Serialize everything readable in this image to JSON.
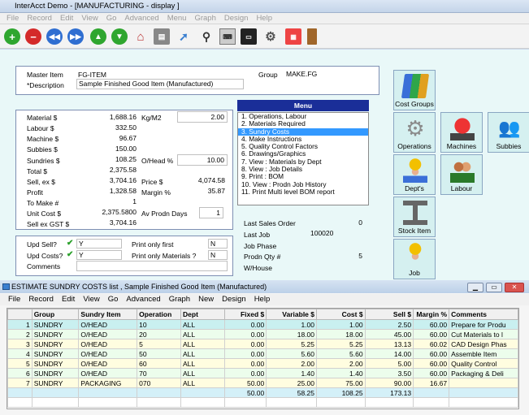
{
  "app": {
    "title": "InterAcct Demo - [MANUFACTURING - display ]"
  },
  "menubar": [
    "File",
    "Record",
    "Edit",
    "View",
    "Go",
    "Advanced",
    "Menu",
    "Graph",
    "Design",
    "Help"
  ],
  "toolbar": [
    "add-icon",
    "delete-icon",
    "first-icon",
    "previous-icon",
    "next-icon",
    "last-icon",
    "home-icon",
    "print-icon",
    "export-icon",
    "search-icon",
    "keyboard-icon",
    "monitor-icon",
    "settings-icon",
    "calendar-icon",
    "exit-door-icon"
  ],
  "header": {
    "master_item_label": "Master Item",
    "master_item_value": "FG-ITEM",
    "description_label": "*Description",
    "description_value": "Sample Finished Good Item (Manufactured)",
    "group_label": "Group",
    "group_value": "MAKE.FG"
  },
  "costs": {
    "material_label": "Material $",
    "material": "1,688.16",
    "labour_label": "Labour  $",
    "labour": "332.50",
    "machine_label": "Machine  $",
    "machine": "96.67",
    "subbies_label": "Subbies  $",
    "subbies": "150.00",
    "sundries_label": "Sundries $",
    "sundries": "108.25",
    "total_label": "Total  $",
    "total": "2,375.58",
    "sell_label": "Sell, ex $",
    "sell": "3,704.16",
    "profit_label": "Profit",
    "profit": "1,328.58",
    "tomake_label": "To Make #",
    "tomake": "1",
    "unitcost_label": "Unit Cost $",
    "unitcost": "2,375.5800",
    "sellgst_label": "Sell ex GST $",
    "sellgst": "3,704.16",
    "kgm2_label": "Kg/M2",
    "kgm2": "2.00",
    "ohead_label": "O/Head %",
    "ohead": "10.00",
    "price_label": "Price $",
    "price": "4,074.58",
    "margin_label": "Margin %",
    "margin": "35.87",
    "avprodn_label": "Av Prodn Days",
    "avprodn": "1"
  },
  "menu": {
    "title": "Menu",
    "items": [
      "1. Operations, Labour",
      "2. Materials Required",
      "3. Sundry Costs",
      "4. Make Instructions",
      "5. Quality Control Factors",
      "6. Drawings/Graphics",
      "7. View : Materials by Dept",
      "8. View : Job Details",
      "9. Print : BOM",
      "10. View : Prodn Job History",
      "11. Print Multi level BOM report"
    ],
    "selected_index": 2
  },
  "options": {
    "upd_sell_label": "Upd Sell?",
    "upd_sell": "Y",
    "upd_costs_label": "Upd Costs?",
    "upd_costs": "Y",
    "comments_label": "Comments",
    "print_first_label": "Print only first",
    "print_first": "N",
    "print_materials_label": "Print only Materials ?",
    "print_materials": "N"
  },
  "jobinfo": {
    "last_sales_order_label": "Last Sales Order",
    "last_sales_order": "0",
    "last_job_label": "Last Job",
    "last_job": "100020",
    "job_phase_label": "Job Phase",
    "prodn_qty_label": "Prodn Qty #",
    "prodn_qty": "5",
    "whouse_label": "W/House"
  },
  "buttons": [
    {
      "label": "Cost Groups",
      "icon": "books-icon"
    },
    {
      "label": "Operations",
      "icon": "gears-icon"
    },
    {
      "label": "Machines",
      "icon": "compressor-icon"
    },
    {
      "label": "Subbies",
      "icon": "people-icon"
    },
    {
      "label": "Dept's",
      "icon": "worker-icon"
    },
    {
      "label": "Labour",
      "icon": "labour-icon"
    },
    {
      "label": "Stock Item",
      "icon": "steel-beam-icon"
    },
    {
      "label": "Job",
      "icon": "job-worker-icon"
    }
  ],
  "subwindow": {
    "title": "ESTIMATE SUNDRY COSTS list , Sample Finished Good Item (Manufactured)",
    "menu": [
      "File",
      "Record",
      "Edit",
      "View",
      "Go",
      "Advanced",
      "Graph",
      "New",
      "Design",
      "Help"
    ],
    "columns": [
      "Group",
      "Sundry Item",
      "Operation",
      "Dept",
      "Fixed $",
      "Variable $",
      "Cost $",
      "Sell $",
      "Margin %",
      "Comments"
    ],
    "rows": [
      {
        "n": "1",
        "group": "SUNDRY",
        "item": "O/HEAD",
        "op": "10",
        "dept": "ALL",
        "fixed": "0.00",
        "variable": "1.00",
        "cost": "1.00",
        "sell": "2.50",
        "margin": "60.00",
        "comments": "Prepare for Produ"
      },
      {
        "n": "2",
        "group": "SUNDRY",
        "item": "O/HEAD",
        "op": "20",
        "dept": "ALL",
        "fixed": "0.00",
        "variable": "18.00",
        "cost": "18.00",
        "sell": "45.00",
        "margin": "60.00",
        "comments": "Cut Materials to l"
      },
      {
        "n": "3",
        "group": "SUNDRY",
        "item": "O/HEAD",
        "op": "5",
        "dept": "ALL",
        "fixed": "0.00",
        "variable": "5.25",
        "cost": "5.25",
        "sell": "13.13",
        "margin": "60.02",
        "comments": "CAD Design Phas"
      },
      {
        "n": "4",
        "group": "SUNDRY",
        "item": "O/HEAD",
        "op": "50",
        "dept": "ALL",
        "fixed": "0.00",
        "variable": "5.60",
        "cost": "5.60",
        "sell": "14.00",
        "margin": "60.00",
        "comments": "Assemble Item"
      },
      {
        "n": "5",
        "group": "SUNDRY",
        "item": "O/HEAD",
        "op": "60",
        "dept": "ALL",
        "fixed": "0.00",
        "variable": "2.00",
        "cost": "2.00",
        "sell": "5.00",
        "margin": "60.00",
        "comments": "Quality Control"
      },
      {
        "n": "6",
        "group": "SUNDRY",
        "item": "O/HEAD",
        "op": "70",
        "dept": "ALL",
        "fixed": "0.00",
        "variable": "1.40",
        "cost": "1.40",
        "sell": "3.50",
        "margin": "60.00",
        "comments": "Packaging & Deli"
      },
      {
        "n": "7",
        "group": "SUNDRY",
        "item": "PACKAGING",
        "op": "070",
        "dept": "ALL",
        "fixed": "50.00",
        "variable": "25.00",
        "cost": "75.00",
        "sell": "90.00",
        "margin": "16.67",
        "comments": ""
      }
    ],
    "totals": {
      "fixed": "50.00",
      "variable": "58.25",
      "cost": "108.25",
      "sell": "173.13"
    }
  }
}
